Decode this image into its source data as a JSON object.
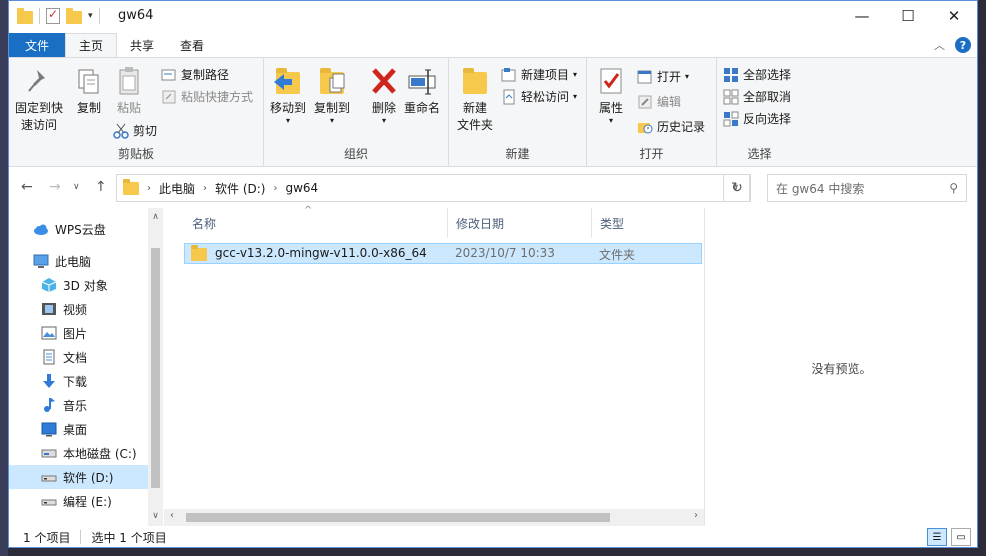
{
  "window": {
    "title": "gw64"
  },
  "tabs": [
    {
      "label": "文件"
    },
    {
      "label": "主页"
    },
    {
      "label": "共享"
    },
    {
      "label": "查看"
    }
  ],
  "ribbon": {
    "clipboard": {
      "pin_label_1": "固定到快",
      "pin_label_2": "速访问",
      "copy": "复制",
      "paste": "粘贴",
      "copy_path": "复制路径",
      "paste_shortcut": "粘贴快捷方式",
      "cut": "剪切",
      "group": "剪贴板"
    },
    "organize": {
      "move_to": "移动到",
      "copy_to": "复制到",
      "delete": "删除",
      "rename": "重命名",
      "group": "组织"
    },
    "new": {
      "new_folder_1": "新建",
      "new_folder_2": "文件夹",
      "new_item": "新建项目",
      "easy_access": "轻松访问",
      "group": "新建"
    },
    "open": {
      "properties": "属性",
      "open": "打开",
      "edit": "编辑",
      "history": "历史记录",
      "group": "打开"
    },
    "select": {
      "select_all": "全部选择",
      "select_none": "全部取消",
      "invert": "反向选择",
      "group": "选择"
    }
  },
  "address": {
    "crumbs": [
      "此电脑",
      "软件 (D:)",
      "gw64"
    ],
    "search_placeholder": "在 gw64 中搜索"
  },
  "nav": {
    "items": [
      {
        "label": "WPS云盘",
        "icon": "cloud-icon"
      },
      {
        "label": "此电脑",
        "icon": "computer-icon"
      },
      {
        "label": "3D 对象",
        "icon": "cube-icon"
      },
      {
        "label": "视频",
        "icon": "video-icon"
      },
      {
        "label": "图片",
        "icon": "picture-icon"
      },
      {
        "label": "文档",
        "icon": "document-icon"
      },
      {
        "label": "下载",
        "icon": "download-icon"
      },
      {
        "label": "音乐",
        "icon": "music-icon"
      },
      {
        "label": "桌面",
        "icon": "desktop-icon"
      },
      {
        "label": "本地磁盘 (C:)",
        "icon": "drive-icon"
      },
      {
        "label": "软件 (D:)",
        "icon": "drive-icon"
      },
      {
        "label": "编程 (E:)",
        "icon": "drive-icon"
      }
    ]
  },
  "files": {
    "columns": [
      "名称",
      "修改日期",
      "类型"
    ],
    "rows": [
      {
        "name": "gcc-v13.2.0-mingw-v11.0.0-x86_64",
        "date": "2023/10/7 10:33",
        "type": "文件夹"
      }
    ]
  },
  "preview": {
    "text": "没有预览。"
  },
  "status": {
    "count": "1 个项目",
    "selected": "选中 1 个项目"
  },
  "colors": {
    "accent": "#1a6fc4",
    "selection": "#cce8ff",
    "folder": "#f6c94c"
  }
}
